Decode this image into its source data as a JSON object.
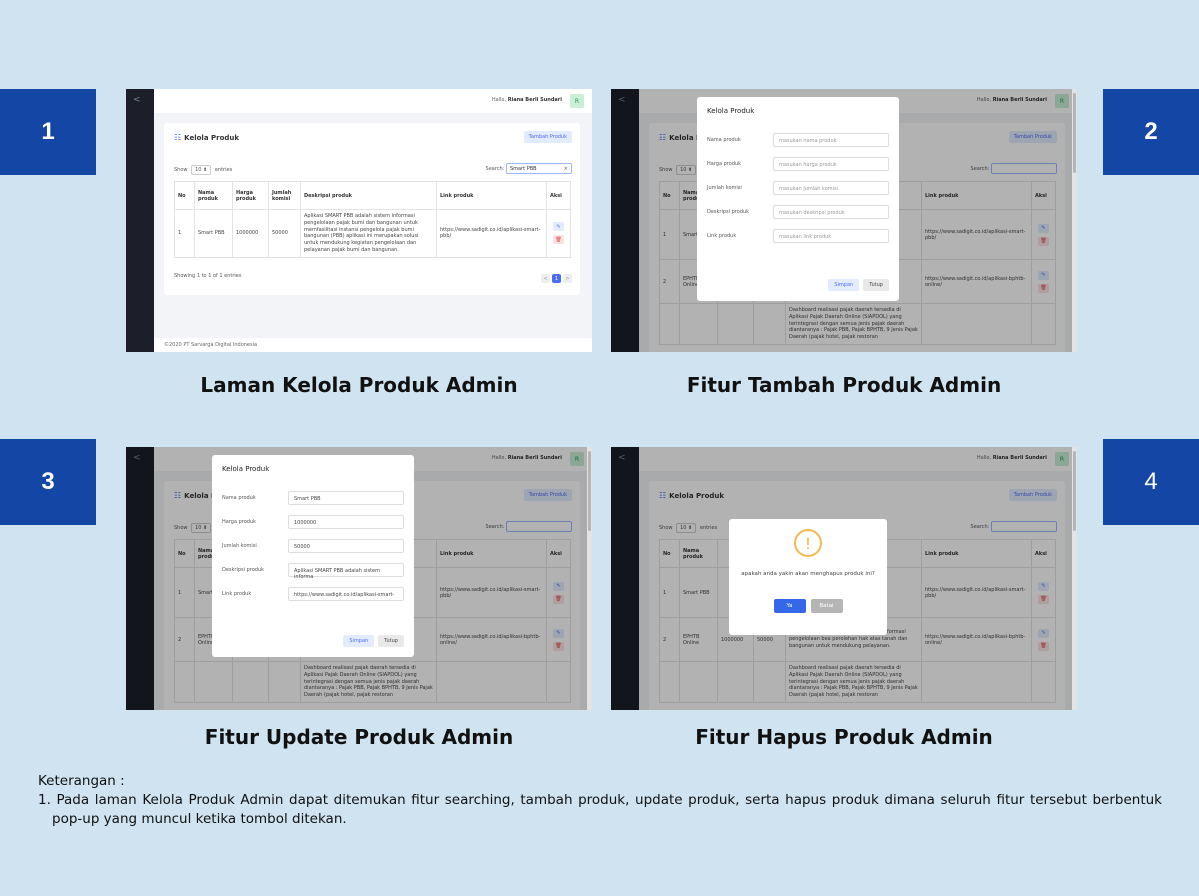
{
  "steps": [
    "1",
    "2",
    "3",
    "4"
  ],
  "captions": [
    "Laman Kelola Produk Admin",
    "Fitur Tambah Produk Admin",
    "Fitur Update Produk Admin",
    "Fitur Hapus Produk Admin"
  ],
  "app": {
    "hello": "Hallo,",
    "user": "Riana Berli Sundari",
    "avatar": "R",
    "nav_toggle": "<",
    "page_title": "Kelola Produk",
    "add_button": "Tambah Produk",
    "show": "Show",
    "entries": "entries",
    "entries_value": "10",
    "search_label": "Search:",
    "search_value": "Smart PBB",
    "columns": [
      "No",
      "Nama produk",
      "Harga produk",
      "Jumlah komisi",
      "Deskripsi produk",
      "Link produk",
      "Aksi"
    ],
    "rows": [
      {
        "no": "1",
        "name": "Smart PBB",
        "price": "1000000",
        "commission": "50000",
        "desc": "Aplikasi SMART PBB adalah sistem informasi pengelolaan pajak bumi dan bangunan untuk memfasilitasi instansi pengelola pajak bumi bangunan (PBB) aplikasi ini merupakan solusi untuk mendukung kegiatan pengelolaan dan pelayanan pajak bumi dan bangunan.",
        "link": "https://www.sadigit.co.id/aplikasi-smart-pbb/"
      },
      {
        "no": "2",
        "name": "EPHTB Online",
        "price": "1000000",
        "commission": "50000",
        "desc": "Aplikasi BPHTB Online adalah sistem informasi pengelolaan bea perolehan hak atas tanah dan bangunan untuk mendukung pelayanan.",
        "link": "https://www.sadigit.co.id/aplikasi-bphtb-online/"
      },
      {
        "desc": "Dashboard realisasi pajak daerah tersedia di Aplikasi Pajak Daerah Online (SIAPDOL) yang terintegrasi dengan semua jenis pajak daerah diantaranya : Pajak PBB, Pajak BPHTB, 9 Jenis Pajak Daerah (pajak hotel, pajak restoran"
      }
    ],
    "showing": "Showing 1 to 1 of 1 entries",
    "pager": [
      "<",
      "1",
      ">"
    ],
    "footer": "©2020 PT Sarvarga Digital Indonesia"
  },
  "modal": {
    "title": "Kelola Produk",
    "labels": [
      "Nama produk",
      "Harga produk",
      "Jumlah komisi",
      "Deskripsi produk",
      "Link produk"
    ],
    "placeholders": [
      "masukan nama produk",
      "masukan harga produk",
      "masukan jumlah komisi",
      "masukan deskripsi produk",
      "masukan link produk"
    ],
    "values": [
      "Smart PBB",
      "1000000",
      "50000",
      "Aplikasi SMART PBB adalah sistem informa",
      "https://www.sadigit.co.id/aplikasi-smart-"
    ],
    "save": "Simpan",
    "close": "Tutup"
  },
  "delete_dialog": {
    "icon": "!",
    "message": "apakah anda yakin akan menghapus produk ini?",
    "yes": "Ya",
    "cancel": "Batal"
  },
  "note": {
    "title": "Keterangan :",
    "items": [
      "1. Pada laman Kelola Produk Admin dapat ditemukan fitur searching, tambah produk, update produk, serta hapus produk dimana seluruh fitur tersebut berbentuk pop-up yang muncul ketika tombol ditekan."
    ]
  },
  "colors": {
    "background": "#cfe3f0",
    "step_badge": "#1446a6",
    "sidebar": "#1c1f2a",
    "accent": "#4a6cf7",
    "danger": "#e04545",
    "warning": "#f3b94e"
  }
}
